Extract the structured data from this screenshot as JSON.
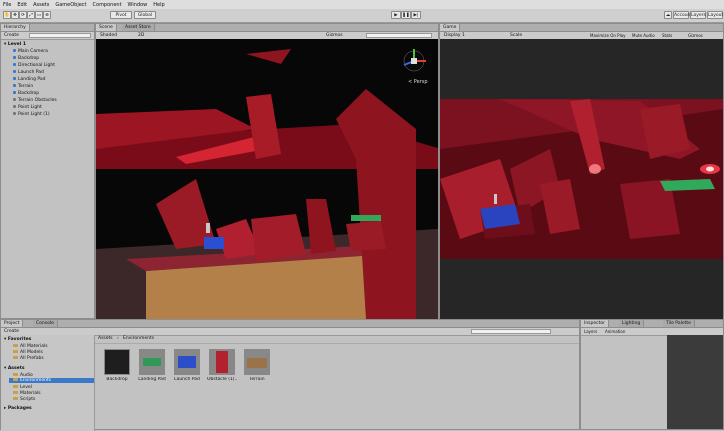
{
  "menu": [
    "File",
    "Edit",
    "Assets",
    "GameObject",
    "Component",
    "Window",
    "Help"
  ],
  "toolbar": {
    "pivot": "Pivot",
    "global": "Global",
    "account": "Account",
    "layers": "Layers",
    "layout": "Layout"
  },
  "hierarchy": {
    "tab": "Hierarchy",
    "create": "Create",
    "scene": "Level 1",
    "items": [
      "Main Camera",
      "Backdrop",
      "Directional Light",
      "Launch Pad",
      "Landing Pad",
      "Terrain",
      "Backdrop",
      "Terrain Obstacles",
      "Point Light",
      "Point Light (1)"
    ]
  },
  "scene": {
    "tab": "Scene",
    "asset_store_tab": "Asset Store",
    "shaded": "Shaded",
    "twod": "2D",
    "gizmos": "Gizmos",
    "persp": "< Persp"
  },
  "game": {
    "tab": "Game",
    "display": "Display 1",
    "scale": "Scale",
    "options": [
      "Maximize On Play",
      "Mute Audio",
      "Stats",
      "Gizmos"
    ]
  },
  "project": {
    "tab": "Project",
    "console_tab": "Console",
    "create": "Create",
    "favorites": {
      "label": "Favorites",
      "items": [
        "All Materials",
        "All Models",
        "All Prefabs"
      ]
    },
    "assets": {
      "label": "Assets",
      "items": [
        "Audio",
        "Environments",
        "Level",
        "Materials",
        "Scripts"
      ]
    },
    "packages": "Packages",
    "breadcrumb_root": "Assets",
    "breadcrumb_current": "Environments",
    "grid": [
      {
        "name": "Backdrop",
        "color": "#1e1e1e"
      },
      {
        "name": "Landing Pad",
        "color": "#2f9a56"
      },
      {
        "name": "Launch Pad",
        "color": "#2a4fc8"
      },
      {
        "name": "Obstacle (1)...",
        "color": "#b2212e"
      },
      {
        "name": "Terrain",
        "color": "#9a7448"
      }
    ]
  },
  "inspector": {
    "tab": "Inspector",
    "lighting_tab": "Lighting",
    "timeline_tab": "Tile Palette",
    "sub": [
      "Layers",
      "Animation"
    ]
  }
}
